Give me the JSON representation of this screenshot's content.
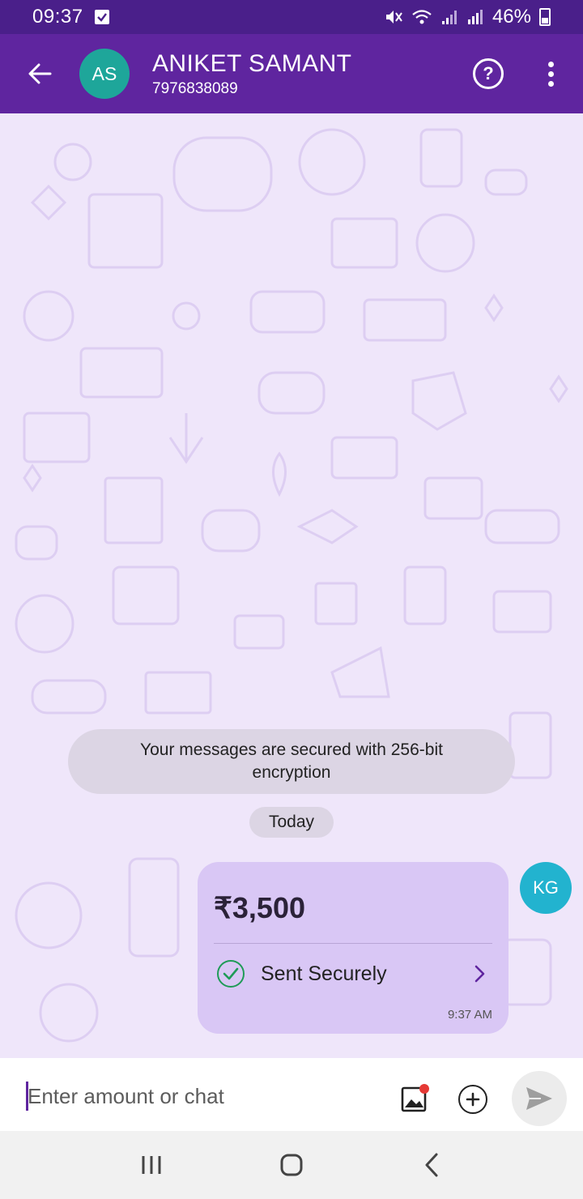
{
  "status_bar": {
    "time": "09:37",
    "battery": "46%"
  },
  "header": {
    "avatar_initials": "AS",
    "contact_name": "ANIKET SAMANT",
    "contact_phone": "7976838089",
    "help_icon": "question-circle-icon",
    "more_icon": "more-vertical-icon",
    "back_icon": "arrow-left-icon"
  },
  "chat": {
    "encryption_notice": "Your messages are secured with 256-bit encryption",
    "date_label": "Today",
    "messages": [
      {
        "amount": "₹3,500",
        "status": "Sent Securely",
        "time": "9:37 AM",
        "sender_initials": "KG"
      }
    ]
  },
  "composer": {
    "placeholder": "Enter amount or chat",
    "value": ""
  },
  "colors": {
    "primary": "#5f259f",
    "status_bar": "#4a1f8a",
    "bubble": "#d9c7f5",
    "success": "#1f9b57",
    "avatar_contact": "#1ea69a",
    "avatar_sender": "#22b3cf"
  }
}
